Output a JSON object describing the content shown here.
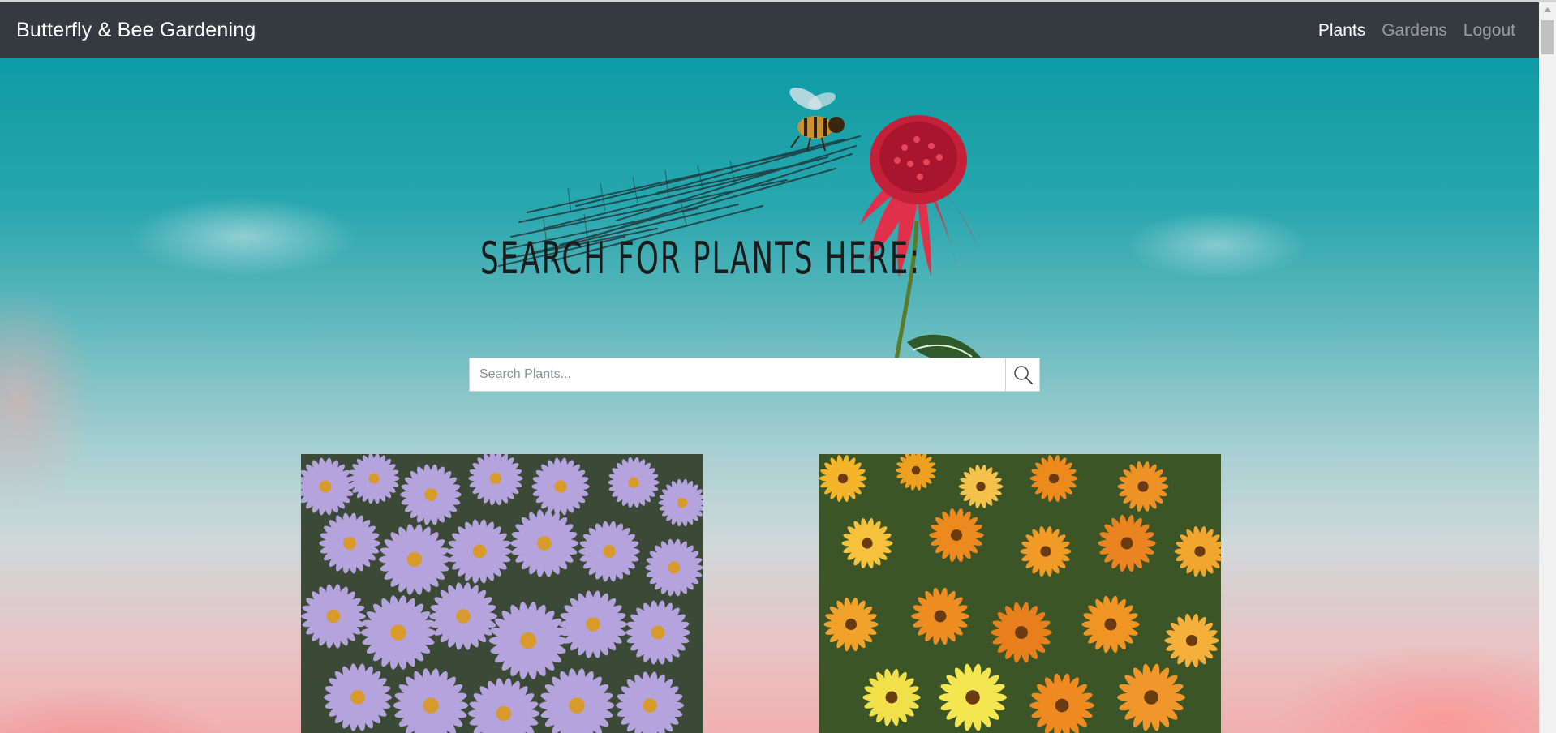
{
  "navbar": {
    "brand": "Butterfly & Bee Gardening",
    "links": [
      {
        "label": "Plants",
        "active": true
      },
      {
        "label": "Gardens",
        "active": false
      },
      {
        "label": "Logout",
        "active": false
      }
    ]
  },
  "hero": {
    "headline": "Search for plants here:"
  },
  "search": {
    "placeholder": "Search Plants...",
    "value": "",
    "button_icon": "search-icon"
  },
  "cards": [
    {
      "image": "purple-aster-flowers"
    },
    {
      "image": "orange-yellow-calendula-flowers"
    }
  ],
  "colors": {
    "navbar_bg": "#343a40",
    "sky_top": "#0e9ba5",
    "sky_bottom": "#f1b0b0"
  }
}
